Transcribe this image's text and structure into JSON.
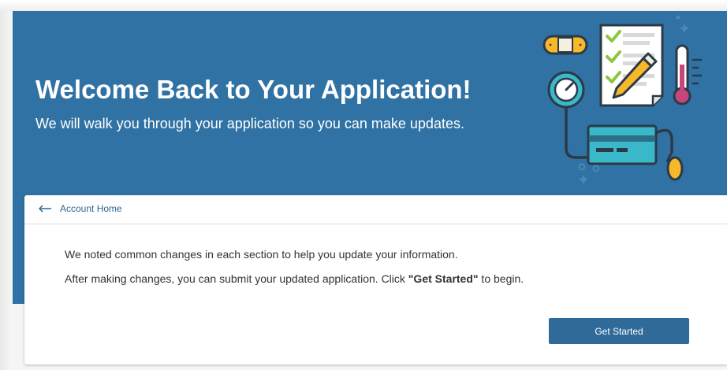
{
  "banner": {
    "title": "Welcome Back to Your Application!",
    "subtitle": "We will walk you through your application so you can make updates."
  },
  "nav": {
    "back_label": "Account Home"
  },
  "content": {
    "line1": "We noted common changes in each section to help you update your information.",
    "line2_before": "After making changes, you can submit your updated application. Click ",
    "line2_bold": "\"Get Started\"",
    "line2_after": " to begin."
  },
  "actions": {
    "get_started_label": "Get Started"
  },
  "colors": {
    "banner_bg": "#2f72a3",
    "button_bg": "#2f6a98",
    "link": "#2f6792",
    "check": "#8cc63f",
    "bandage": "#f7b82a",
    "thermometer": "#c7477d",
    "card_teal": "#3ab7c9"
  },
  "icons": {
    "back": "arrow-left-icon",
    "illustration": "medical-checklist-illustration"
  }
}
